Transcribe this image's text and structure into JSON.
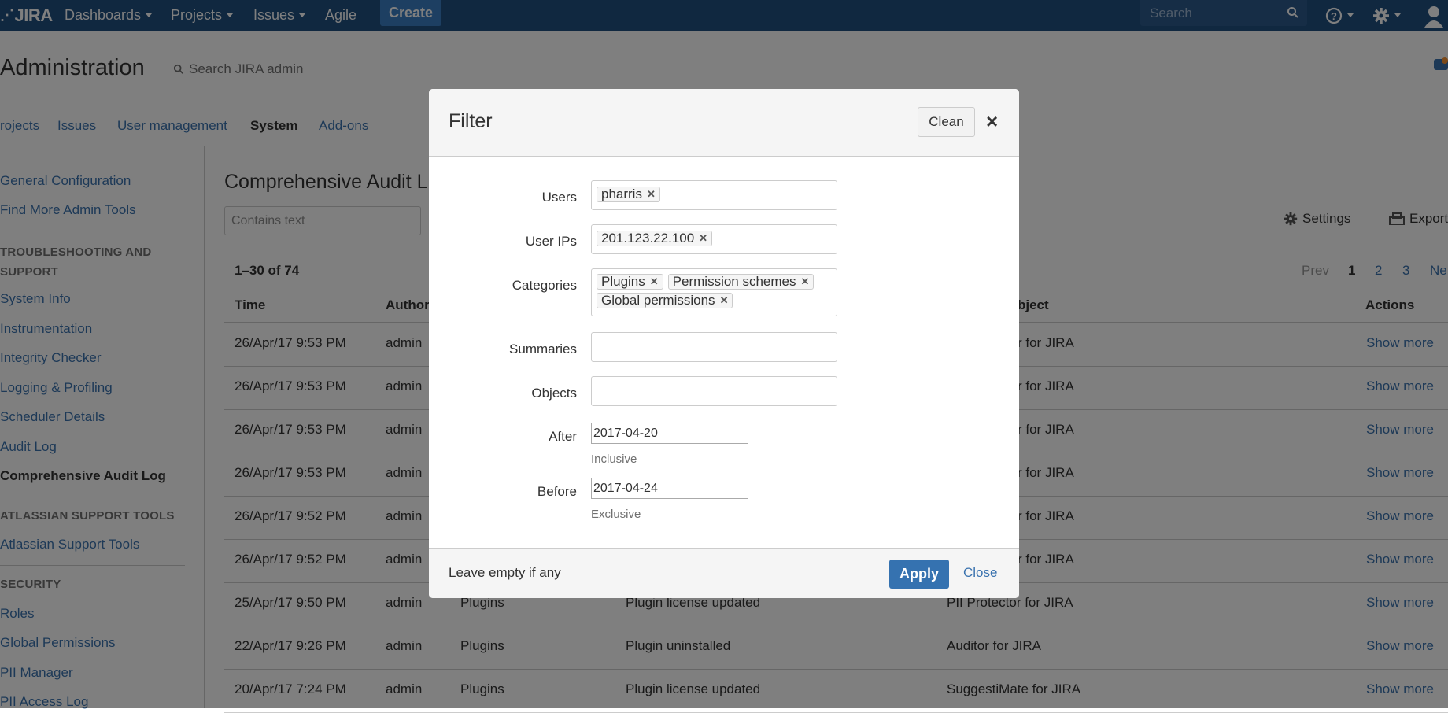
{
  "topnav": {
    "logo": "JIRA",
    "items": [
      "Dashboards",
      "Projects",
      "Issues",
      "Agile"
    ],
    "create_label": "Create",
    "search_placeholder": "Search"
  },
  "admin": {
    "title": "Administration",
    "search_label": "Search JIRA admin",
    "tabs": [
      "rojects",
      "Issues",
      "User management",
      "System",
      "Add-ons"
    ],
    "active_tab": "System"
  },
  "sidebar": {
    "links_top": [
      "General Configuration",
      "Find More Admin Tools"
    ],
    "heading_troubleshooting": "TROUBLESHOOTING AND SUPPORT",
    "links_troubleshooting": [
      "System Info",
      "Instrumentation",
      "Integrity Checker",
      "Logging & Profiling",
      "Scheduler Details",
      "Audit Log",
      "Comprehensive Audit Log"
    ],
    "heading_atlassian": "ATLASSIAN SUPPORT TOOLS",
    "links_atlassian": [
      "Atlassian Support Tools"
    ],
    "heading_security": "SECURITY",
    "links_security": [
      "Roles",
      "Global Permissions",
      "PII Manager",
      "PII Access Log"
    ]
  },
  "main": {
    "title": "Comprehensive Audit L",
    "text_filter_placeholder": "Contains text",
    "count": "1–30 of 74",
    "settings_label": "Settings",
    "export_label": "Export",
    "pager": {
      "prev": "Prev",
      "pages": [
        "1",
        "2",
        "3"
      ],
      "next": "Ne"
    },
    "columns": {
      "time": "Time",
      "author": "Author",
      "object": "bject",
      "actions": "Actions"
    },
    "rows": [
      {
        "time": "26/Apr/17 9:53 PM",
        "author": "admin",
        "category": "",
        "summary": "",
        "object": "r for JIRA",
        "action": "Show more"
      },
      {
        "time": "26/Apr/17 9:53 PM",
        "author": "admin",
        "category": "",
        "summary": "",
        "object": "r for JIRA",
        "action": "Show more"
      },
      {
        "time": "26/Apr/17 9:53 PM",
        "author": "admin",
        "category": "",
        "summary": "",
        "object": "r for JIRA",
        "action": "Show more"
      },
      {
        "time": "26/Apr/17 9:53 PM",
        "author": "admin",
        "category": "",
        "summary": "",
        "object": "r for JIRA",
        "action": "Show more"
      },
      {
        "time": "26/Apr/17 9:52 PM",
        "author": "admin",
        "category": "",
        "summary": "",
        "object": "r for JIRA",
        "action": "Show more"
      },
      {
        "time": "26/Apr/17 9:52 PM",
        "author": "admin",
        "category": "",
        "summary": "",
        "object": "r for JIRA",
        "action": "Show more"
      },
      {
        "time": "25/Apr/17 9:50 PM",
        "author": "admin",
        "category": "Plugins",
        "summary": "Plugin license updated",
        "object": "PII Protector for JIRA",
        "action": "Show more"
      },
      {
        "time": "22/Apr/17 9:26 PM",
        "author": "admin",
        "category": "Plugins",
        "summary": "Plugin uninstalled",
        "object": "Auditor for JIRA",
        "action": "Show more"
      },
      {
        "time": "20/Apr/17 7:24 PM",
        "author": "admin",
        "category": "Plugins",
        "summary": "Plugin license updated",
        "object": "SuggestiMate for JIRA",
        "action": "Show more"
      }
    ]
  },
  "dialog": {
    "title": "Filter",
    "clean_label": "Clean",
    "close_icon": "×",
    "fields": {
      "users_label": "Users",
      "users": [
        "pharris"
      ],
      "ips_label": "User IPs",
      "ips": [
        "201.123.22.100"
      ],
      "categories_label": "Categories",
      "categories": [
        "Plugins",
        "Permission schemes",
        "Global permissions"
      ],
      "summaries_label": "Summaries",
      "objects_label": "Objects",
      "after_label": "After",
      "after_value": "2017-04-20",
      "after_hint": "Inclusive",
      "before_label": "Before",
      "before_value": "2017-04-24",
      "before_hint": "Exclusive"
    },
    "footer_note": "Leave empty if any",
    "apply_label": "Apply",
    "close_label": "Close"
  },
  "colors": {
    "topbar": "#205081",
    "create": "#3b7fc4",
    "link": "#3b73af",
    "apply": "#3572b0"
  }
}
